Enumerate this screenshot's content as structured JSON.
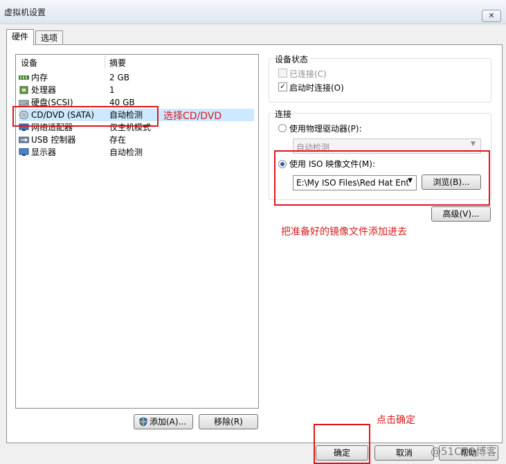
{
  "window": {
    "title": "虚拟机设置",
    "close_label": "✕"
  },
  "tabs": [
    {
      "label": "硬件"
    },
    {
      "label": "选项"
    }
  ],
  "device_list": {
    "headers": {
      "device": "设备",
      "summary": "摘要"
    },
    "rows": [
      {
        "name": "内存",
        "summary": "2 GB",
        "icon": "memory-icon"
      },
      {
        "name": "处理器",
        "summary": "1",
        "icon": "processor-icon"
      },
      {
        "name": "硬盘(SCSI)",
        "summary": "40 GB",
        "icon": "hard-disk-icon"
      },
      {
        "name": "CD/DVD (SATA)",
        "summary": "自动检测",
        "icon": "cd-dvd-icon"
      },
      {
        "name": "网络适配器",
        "summary": "仅主机模式",
        "icon": "network-adapter-icon"
      },
      {
        "name": "USB 控制器",
        "summary": "存在",
        "icon": "usb-icon"
      },
      {
        "name": "显示器",
        "summary": "自动检测",
        "icon": "display-icon"
      }
    ]
  },
  "left_buttons": {
    "add": "添加(A)...",
    "remove": "移除(R)"
  },
  "device_status": {
    "title": "设备状态",
    "connected": "已连接(C)",
    "connect_at_power_on": "启动时连接(O)"
  },
  "connection": {
    "title": "连接",
    "use_physical_drive": "使用物理驱动器(P):",
    "physical_drive_value": "自动检测",
    "use_iso": "使用 ISO 映像文件(M):",
    "iso_path": "E:\\My ISO Files\\Red Hat Ent",
    "browse": "浏览(B)...",
    "advanced": "高级(V)..."
  },
  "annotations": {
    "select_cd": "选择CD/DVD",
    "add_iso": "把准备好的镜像文件添加进去",
    "click_ok": "点击确定"
  },
  "footer": {
    "ok": "确定",
    "cancel": "取消",
    "help": "帮助"
  },
  "watermark": "@51CTO博客",
  "colors": {
    "annotation_red": "#e0141a",
    "selection": "#cde8ff"
  }
}
